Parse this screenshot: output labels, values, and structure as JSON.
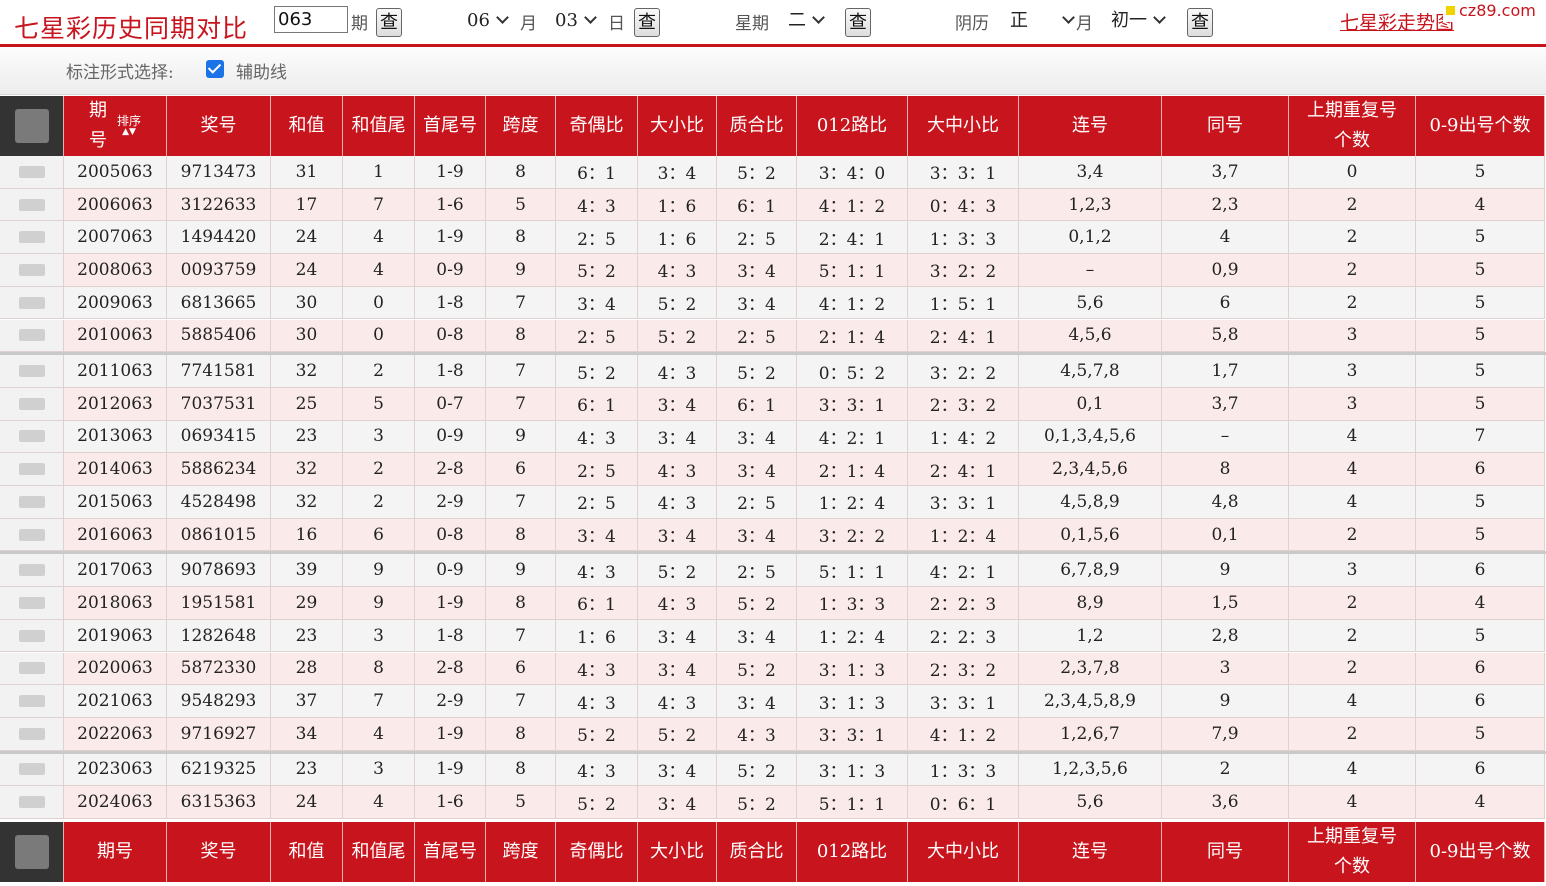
{
  "header": {
    "title": "七星彩历史同期对比",
    "issue_value": "063",
    "issue_unit": "期",
    "query_label": "查",
    "month_value": "06",
    "month_unit": "月",
    "day_value": "03",
    "day_unit": "日",
    "weekday_label": "星期",
    "weekday_value": "二",
    "lunar_label": "阴历",
    "lunar_month_value": "正",
    "lunar_month_unit": "月",
    "lunar_day_value": "初一",
    "trend_link": "七星彩走势图",
    "watermark": "cz89.com"
  },
  "options": {
    "label": "标注形式选择:",
    "checkbox_label": "辅助线",
    "checked": true
  },
  "columns": {
    "issue_line1": "期",
    "issue_line2": "号",
    "sort_label": "排序",
    "sort_arrows": "▲▼",
    "number": "奖号",
    "sum": "和值",
    "sum_tail": "和值尾",
    "head_tail": "首尾号",
    "span": "跨度",
    "odd_even": "奇偶比",
    "big_small": "大小比",
    "prime_comp": "质合比",
    "route012": "012路比",
    "big_mid_small": "大中小比",
    "consecutive": "连号",
    "same": "同号",
    "repeat_line1": "上期重复号",
    "repeat_line2": "个数",
    "digit_count": "0-9出号个数",
    "footer_issue": "期号"
  },
  "rows": [
    {
      "issue": "2005063",
      "number": "9713473",
      "sum": "31",
      "tail": "1",
      "ht": "1-9",
      "span": "8",
      "oe": "6：1",
      "bs": "3：4",
      "pc": "5：2",
      "r012": "3：4：0",
      "bms": "3：3：1",
      "cons": "3,4",
      "same": "3,7",
      "rep": "0",
      "cnt": "5"
    },
    {
      "issue": "2006063",
      "number": "3122633",
      "sum": "17",
      "tail": "7",
      "ht": "1-6",
      "span": "5",
      "oe": "4：3",
      "bs": "1：6",
      "pc": "6：1",
      "r012": "4：1：2",
      "bms": "0：4：3",
      "cons": "1,2,3",
      "same": "2,3",
      "rep": "2",
      "cnt": "4"
    },
    {
      "issue": "2007063",
      "number": "1494420",
      "sum": "24",
      "tail": "4",
      "ht": "1-9",
      "span": "8",
      "oe": "2：5",
      "bs": "1：6",
      "pc": "2：5",
      "r012": "2：4：1",
      "bms": "1：3：3",
      "cons": "0,1,2",
      "same": "4",
      "rep": "2",
      "cnt": "5"
    },
    {
      "issue": "2008063",
      "number": "0093759",
      "sum": "24",
      "tail": "4",
      "ht": "0-9",
      "span": "9",
      "oe": "5：2",
      "bs": "4：3",
      "pc": "3：4",
      "r012": "5：1：1",
      "bms": "3：2：2",
      "cons": "–",
      "same": "0,9",
      "rep": "2",
      "cnt": "5"
    },
    {
      "issue": "2009063",
      "number": "6813665",
      "sum": "30",
      "tail": "0",
      "ht": "1-8",
      "span": "7",
      "oe": "3：4",
      "bs": "5：2",
      "pc": "3：4",
      "r012": "4：1：2",
      "bms": "1：5：1",
      "cons": "5,6",
      "same": "6",
      "rep": "2",
      "cnt": "5"
    },
    {
      "issue": "2010063",
      "number": "5885406",
      "sum": "30",
      "tail": "0",
      "ht": "0-8",
      "span": "8",
      "oe": "2：5",
      "bs": "5：2",
      "pc": "2：5",
      "r012": "2：1：4",
      "bms": "2：4：1",
      "cons": "4,5,6",
      "same": "5,8",
      "rep": "3",
      "cnt": "5"
    },
    {
      "issue": "2011063",
      "number": "7741581",
      "sum": "32",
      "tail": "2",
      "ht": "1-8",
      "span": "7",
      "oe": "5：2",
      "bs": "4：3",
      "pc": "5：2",
      "r012": "0：5：2",
      "bms": "3：2：2",
      "cons": "4,5,7,8",
      "same": "1,7",
      "rep": "3",
      "cnt": "5"
    },
    {
      "issue": "2012063",
      "number": "7037531",
      "sum": "25",
      "tail": "5",
      "ht": "0-7",
      "span": "7",
      "oe": "6：1",
      "bs": "3：4",
      "pc": "6：1",
      "r012": "3：3：1",
      "bms": "2：3：2",
      "cons": "0,1",
      "same": "3,7",
      "rep": "3",
      "cnt": "5"
    },
    {
      "issue": "2013063",
      "number": "0693415",
      "sum": "23",
      "tail": "3",
      "ht": "0-9",
      "span": "9",
      "oe": "4：3",
      "bs": "3：4",
      "pc": "3：4",
      "r012": "4：2：1",
      "bms": "1：4：2",
      "cons": "0,1,3,4,5,6",
      "same": "–",
      "rep": "4",
      "cnt": "7"
    },
    {
      "issue": "2014063",
      "number": "5886234",
      "sum": "32",
      "tail": "2",
      "ht": "2-8",
      "span": "6",
      "oe": "2：5",
      "bs": "4：3",
      "pc": "3：4",
      "r012": "2：1：4",
      "bms": "2：4：1",
      "cons": "2,3,4,5,6",
      "same": "8",
      "rep": "4",
      "cnt": "6"
    },
    {
      "issue": "2015063",
      "number": "4528498",
      "sum": "32",
      "tail": "2",
      "ht": "2-9",
      "span": "7",
      "oe": "2：5",
      "bs": "4：3",
      "pc": "2：5",
      "r012": "1：2：4",
      "bms": "3：3：1",
      "cons": "4,5,8,9",
      "same": "4,8",
      "rep": "4",
      "cnt": "5"
    },
    {
      "issue": "2016063",
      "number": "0861015",
      "sum": "16",
      "tail": "6",
      "ht": "0-8",
      "span": "8",
      "oe": "3：4",
      "bs": "3：4",
      "pc": "3：4",
      "r012": "3：2：2",
      "bms": "1：2：4",
      "cons": "0,1,5,6",
      "same": "0,1",
      "rep": "2",
      "cnt": "5"
    },
    {
      "issue": "2017063",
      "number": "9078693",
      "sum": "39",
      "tail": "9",
      "ht": "0-9",
      "span": "9",
      "oe": "4：3",
      "bs": "5：2",
      "pc": "2：5",
      "r012": "5：1：1",
      "bms": "4：2：1",
      "cons": "6,7,8,9",
      "same": "9",
      "rep": "3",
      "cnt": "6"
    },
    {
      "issue": "2018063",
      "number": "1951581",
      "sum": "29",
      "tail": "9",
      "ht": "1-9",
      "span": "8",
      "oe": "6：1",
      "bs": "4：3",
      "pc": "5：2",
      "r012": "1：3：3",
      "bms": "2：2：3",
      "cons": "8,9",
      "same": "1,5",
      "rep": "2",
      "cnt": "4"
    },
    {
      "issue": "2019063",
      "number": "1282648",
      "sum": "23",
      "tail": "3",
      "ht": "1-8",
      "span": "7",
      "oe": "1：6",
      "bs": "3：4",
      "pc": "3：4",
      "r012": "1：2：4",
      "bms": "2：2：3",
      "cons": "1,2",
      "same": "2,8",
      "rep": "2",
      "cnt": "5"
    },
    {
      "issue": "2020063",
      "number": "5872330",
      "sum": "28",
      "tail": "8",
      "ht": "2-8",
      "span": "6",
      "oe": "4：3",
      "bs": "3：4",
      "pc": "5：2",
      "r012": "3：1：3",
      "bms": "2：3：2",
      "cons": "2,3,7,8",
      "same": "3",
      "rep": "2",
      "cnt": "6"
    },
    {
      "issue": "2021063",
      "number": "9548293",
      "sum": "37",
      "tail": "7",
      "ht": "2-9",
      "span": "7",
      "oe": "4：3",
      "bs": "4：3",
      "pc": "3：4",
      "r012": "3：1：3",
      "bms": "3：3：1",
      "cons": "2,3,4,5,8,9",
      "same": "9",
      "rep": "4",
      "cnt": "6"
    },
    {
      "issue": "2022063",
      "number": "9716927",
      "sum": "34",
      "tail": "4",
      "ht": "1-9",
      "span": "8",
      "oe": "5：2",
      "bs": "5：2",
      "pc": "4：3",
      "r012": "3：3：1",
      "bms": "4：1：2",
      "cons": "1,2,6,7",
      "same": "7,9",
      "rep": "2",
      "cnt": "5"
    },
    {
      "issue": "2023063",
      "number": "6219325",
      "sum": "23",
      "tail": "3",
      "ht": "1-9",
      "span": "8",
      "oe": "4：3",
      "bs": "3：4",
      "pc": "5：2",
      "r012": "3：1：3",
      "bms": "1：3：3",
      "cons": "1,2,3,5,6",
      "same": "2",
      "rep": "4",
      "cnt": "6"
    },
    {
      "issue": "2024063",
      "number": "6315363",
      "sum": "24",
      "tail": "4",
      "ht": "1-6",
      "span": "5",
      "oe": "5：2",
      "bs": "3：4",
      "pc": "5：2",
      "r012": "5：1：1",
      "bms": "0：6：1",
      "cons": "5,6",
      "same": "3,6",
      "rep": "4",
      "cnt": "4"
    }
  ],
  "colors": {
    "accent": "#c8141c",
    "row_odd": "#f4f4f4",
    "row_even": "#fbeaea",
    "checkbox": "#1a73e8"
  }
}
